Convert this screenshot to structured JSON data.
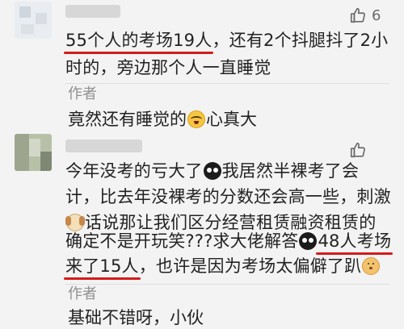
{
  "comments": [
    {
      "likes": "6",
      "lines": [
        {
          "highlight": "55个人的考场19人",
          "rest": "，还有2个抖腿抖了2小"
        },
        {
          "text": "时的，旁边那个人一直睡觉"
        }
      ],
      "reply": {
        "author": "作者",
        "before": "竟然还有睡觉的",
        "emoji": "cry-laugh",
        "after": "心真大"
      }
    },
    {
      "likes": "",
      "lines": [
        {
          "before": "今年没考的亏大了",
          "emoji": "owl",
          "after": "我居然半裸考了会"
        },
        {
          "text": "计，比去年没裸考的分数还会高一些，刺激"
        },
        {
          "emoji": "puppy",
          "after": "话说那让我们区分经营租赁融资租赁的"
        },
        {
          "before": "确定不是开玩笑???求大佬解答",
          "emoji": "owl",
          "highlight": "48人考场"
        },
        {
          "highlight": "来了15人",
          "before2": "，也许是因为考场太偏僻了趴",
          "emoji": "doge"
        }
      ],
      "reply": {
        "author": "作者",
        "text": "基础不错呀，小伙"
      }
    }
  ]
}
